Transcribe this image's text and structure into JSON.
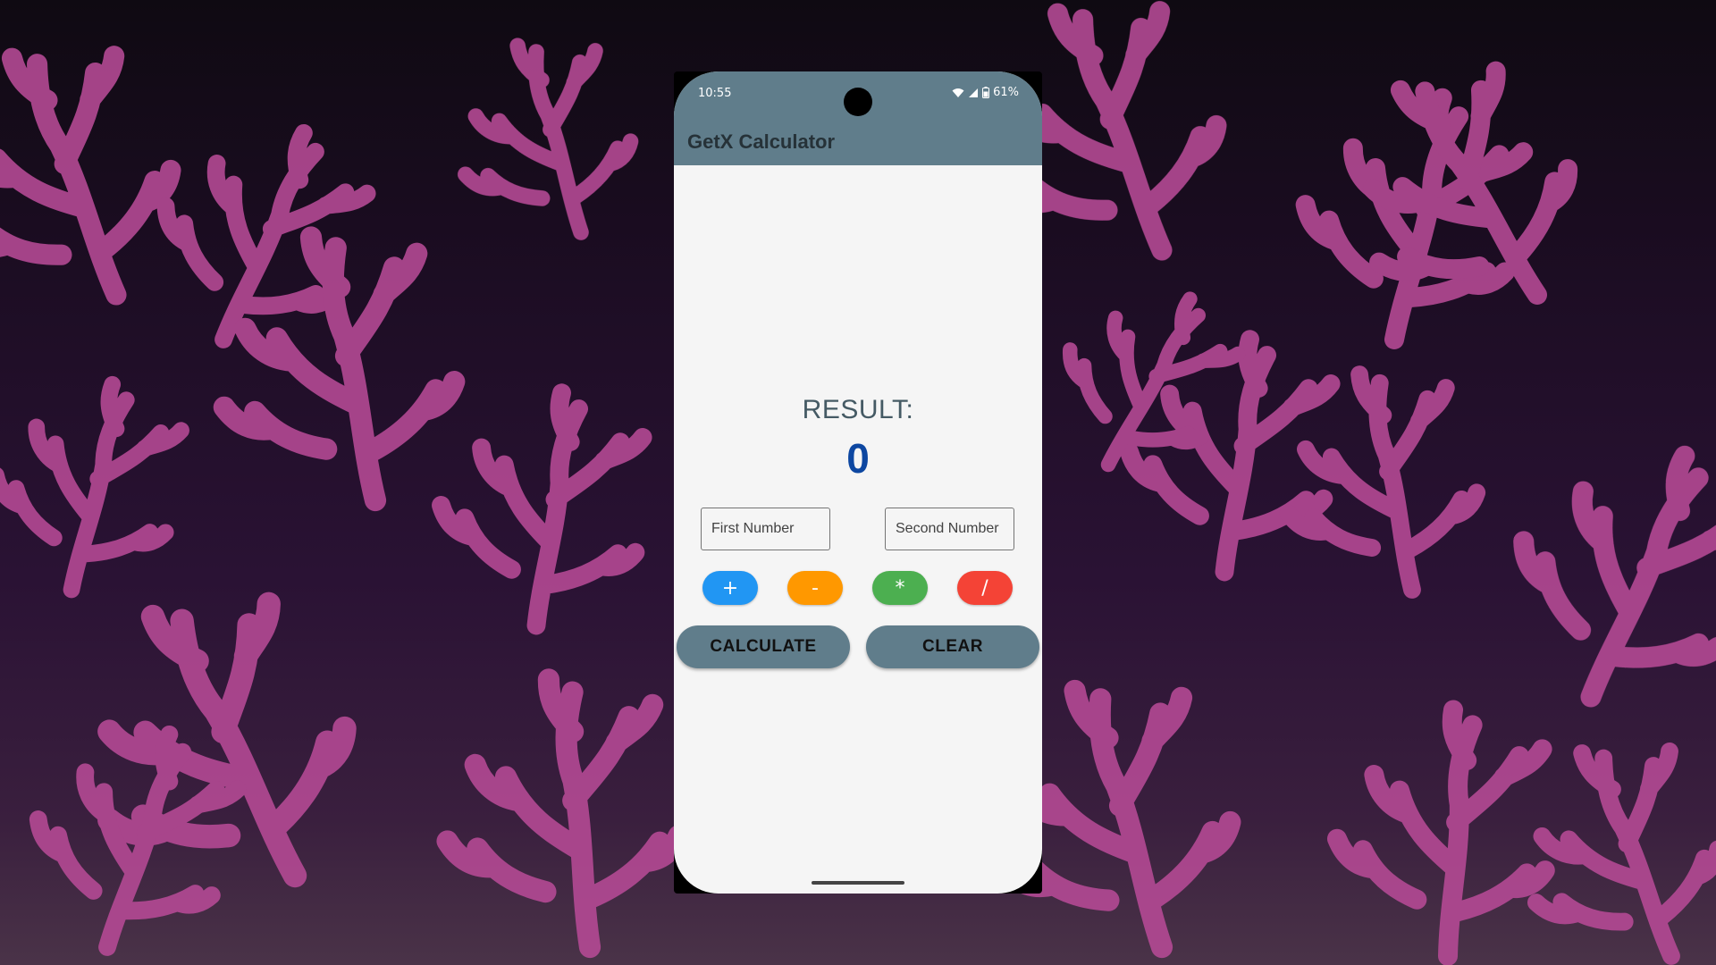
{
  "status_bar": {
    "time": "10:55",
    "battery": "61%"
  },
  "app": {
    "title": "GetX Calculator"
  },
  "result": {
    "label": "RESULT:",
    "value": "0"
  },
  "inputs": {
    "first": {
      "placeholder": "First Number",
      "value": ""
    },
    "second": {
      "placeholder": "Second Number",
      "value": ""
    }
  },
  "operations": [
    {
      "label": "+",
      "color": "#2196f3"
    },
    {
      "label": "-",
      "color": "#ff9800"
    },
    {
      "label": "*",
      "color": "#4caf50"
    },
    {
      "label": "/",
      "color": "#f44336"
    }
  ],
  "actions": {
    "calculate": "CALCULATE",
    "clear": "CLEAR"
  },
  "theme": {
    "primary": "#607d8b",
    "result_color": "#0d47a1",
    "coral": "#b54a95"
  }
}
